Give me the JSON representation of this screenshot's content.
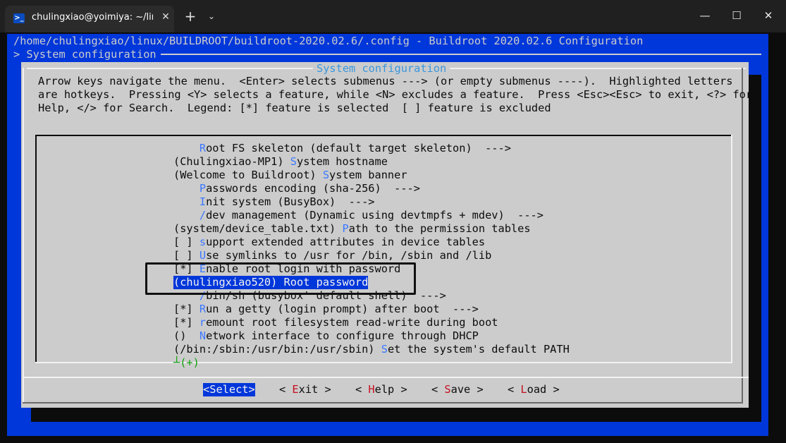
{
  "window": {
    "tab_title": "chulingxiao@yoimiya: ~/linux",
    "tab_icon": ">_",
    "tab_close": "✕",
    "new_tab": "+",
    "dropdown": "⌄",
    "minimize": "—",
    "maximize": "☐",
    "close": "✕"
  },
  "terminal": {
    "path_line": "/home/chulingxiao/linux/BUILDROOT/buildroot-2020.02.6/.config - Buildroot 2020.02.6 Configuration",
    "breadcrumb": "> System configuration",
    "dialog_title": "System configuration",
    "help_lines": [
      "Arrow keys navigate the menu.  <Enter> selects submenus ---> (or empty submenus ----).  Highlighted letters",
      "are hotkeys.  Pressing <Y> selects a feature, while <N> excludes a feature.  Press <Esc><Esc> to exit, <?> for",
      "Help, </> for Search.  Legend: [*] feature is selected  [ ] feature is excluded"
    ],
    "items": [
      {
        "pre": "    ",
        "hk": "R",
        "post": "oot FS skeleton (default target skeleton)  --->"
      },
      {
        "pre": "(Chulingxiao-MP1) ",
        "hk": "S",
        "post": "ystem hostname"
      },
      {
        "pre": "(Welcome to Buildroot) ",
        "hk": "S",
        "post": "ystem banner"
      },
      {
        "pre": "    ",
        "hk": "P",
        "post": "asswords encoding (sha-256)  --->"
      },
      {
        "pre": "    ",
        "hk": "I",
        "post": "nit system (BusyBox)  --->"
      },
      {
        "pre": "    ",
        "hk": "/",
        "post": "dev management (Dynamic using devtmpfs + mdev)  --->"
      },
      {
        "pre": "(system/device_table.txt) ",
        "hk": "P",
        "post": "ath to the permission tables"
      },
      {
        "pre": "[ ] ",
        "hk": "s",
        "post": "upport extended attributes in device tables"
      },
      {
        "pre": "[ ] ",
        "hk": "U",
        "post": "se symlinks to /usr for /bin, /sbin and /lib"
      },
      {
        "pre": "[*] ",
        "hk": "E",
        "post": "nable root login with password"
      },
      {
        "pre": "(chulingxiao520) Root password",
        "hk": "",
        "post": ""
      },
      {
        "pre": "    ",
        "hk": "/",
        "post": "bin/sh (busybox' default shell)  --->"
      },
      {
        "pre": "[*] ",
        "hk": "R",
        "post": "un a getty (login prompt) after boot  --->"
      },
      {
        "pre": "[*] ",
        "hk": "r",
        "post": "emount root filesystem read-write during boot"
      },
      {
        "pre": "()  ",
        "hk": "N",
        "post": "etwork interface to configure through DHCP"
      },
      {
        "pre": "(/bin:/sbin:/usr/bin:/usr/sbin) ",
        "hk": "S",
        "post": "et the system's default PATH"
      }
    ],
    "more_indicator": "┴(+)",
    "buttons": [
      {
        "pre": "<",
        "hk": "S",
        "post": "elect>"
      },
      {
        "pre": "< ",
        "hk": "E",
        "post": "xit >"
      },
      {
        "pre": "< ",
        "hk": "H",
        "post": "elp >"
      },
      {
        "pre": "< ",
        "hk": "S",
        "post": "ave >"
      },
      {
        "pre": "< ",
        "hk": "L",
        "post": "oad >"
      }
    ]
  },
  "colors": {
    "terminal_blue": "#0037da",
    "dialog_gray": "#cccccc",
    "hotkey_blue": "#3b78ff",
    "hotkey_red": "#c50f1f",
    "more_green": "#13a10e"
  }
}
